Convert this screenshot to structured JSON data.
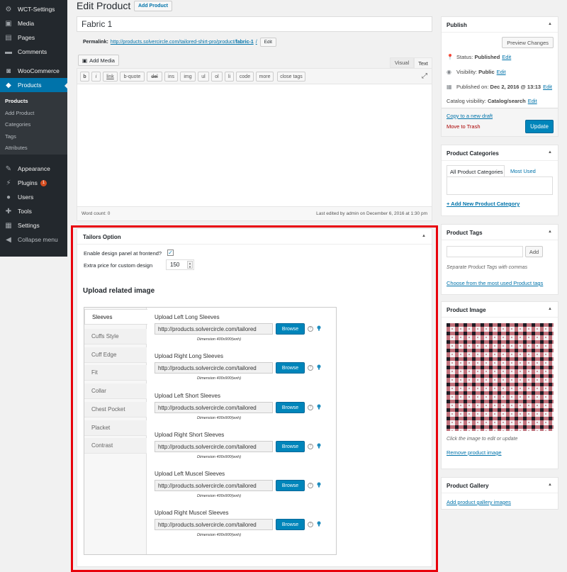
{
  "menu": {
    "items": [
      {
        "label": "WCT-Settings",
        "icon": "gear-icon"
      },
      {
        "label": "Media",
        "icon": "media-icon"
      },
      {
        "label": "Pages",
        "icon": "page-icon"
      },
      {
        "label": "Comments",
        "icon": "comment-icon"
      },
      {
        "label": "WooCommerce",
        "icon": "woocommerce-icon"
      },
      {
        "label": "Products",
        "icon": "products-icon"
      },
      {
        "label": "Appearance",
        "icon": "brush-icon"
      },
      {
        "label": "Plugins",
        "icon": "plugin-icon",
        "badge": "1"
      },
      {
        "label": "Users",
        "icon": "user-icon"
      },
      {
        "label": "Tools",
        "icon": "wrench-icon"
      },
      {
        "label": "Settings",
        "icon": "settings-icon"
      },
      {
        "label": "Collapse menu",
        "icon": "collapse-icon"
      }
    ],
    "submenu": [
      "Products",
      "Add Product",
      "Categories",
      "Tags",
      "Attributes"
    ],
    "colors": {
      "bg": "#23282d",
      "current": "#0073aa"
    }
  },
  "header": {
    "title": "Edit Product",
    "add_button": "Add Product"
  },
  "post": {
    "title": "Fabric 1",
    "permalink_label": "Permalink:",
    "permalink_base": "http://products.solvercircle.com/tailored-shirt-pro/product/",
    "permalink_slug": "fabric-1",
    "permalink_end": "/",
    "permalink_edit": "Edit"
  },
  "editor": {
    "add_media": "Add Media",
    "tab_visual": "Visual",
    "tab_text": "Text",
    "buttons": [
      "b",
      "i",
      "link",
      "b-quote",
      "del",
      "ins",
      "img",
      "ul",
      "ol",
      "li",
      "code",
      "more",
      "close tags"
    ],
    "word_count": "Word count: 0",
    "last_edited": "Last edited by admin on December 6, 2016 at 1:30 pm"
  },
  "tailors": {
    "title": "Tailors Option",
    "design_panel_label": "Enable design panel at frontend?",
    "design_panel_checked": true,
    "check_mark": "✓",
    "extra_price_label": "Extra price for custom design",
    "extra_price_value": "150",
    "upload_heading": "Upload related image",
    "tabs": [
      "Sleeves",
      "Cuffs Style",
      "Cuff Edge",
      "Fit",
      "Collar",
      "Chest Pocket",
      "Placket",
      "Contrast"
    ],
    "uploads": [
      {
        "label": "Upload Left Long Sleeves",
        "value": "http://products.solvercircle.com/tailored"
      },
      {
        "label": "Upload Right Long Sleeves",
        "value": "http://products.solvercircle.com/tailored"
      },
      {
        "label": "Upload Left Short Sleeves",
        "value": "http://products.solvercircle.com/tailored"
      },
      {
        "label": "Upload Right Short Sleeves",
        "value": "http://products.solvercircle.com/tailored"
      },
      {
        "label": "Upload Left Muscel Sleeves",
        "value": "http://products.solvercircle.com/tailored"
      },
      {
        "label": "Upload Right Muscel Sleeves",
        "value": "http://products.solvercircle.com/tailored"
      }
    ],
    "browse_label": "Browse",
    "dimension": "Dimension 400x900(wxh)",
    "help_glyph": "?",
    "highlight_color": "#e8000b"
  },
  "publish": {
    "title": "Publish",
    "preview": "Preview Changes",
    "status_label": "Status:",
    "status_value": "Published",
    "visibility_label": "Visibility:",
    "visibility_value": "Public",
    "published_label": "Published on:",
    "published_value": "Dec 2, 2016 @ 13:13",
    "catalog_label": "Catalog visibility:",
    "catalog_value": "Catalog/search",
    "edit": "Edit",
    "copy_draft": "Copy to a new draft",
    "trash": "Move to Trash",
    "update": "Update"
  },
  "categories": {
    "title": "Product Categories",
    "tab_all": "All Product Categories",
    "tab_most": "Most Used",
    "add_new": "+ Add New Product Category"
  },
  "tags": {
    "title": "Product Tags",
    "add": "Add",
    "hint": "Separate Product Tags with commas",
    "choose": "Choose from the most used Product tags"
  },
  "product_image": {
    "title": "Product Image",
    "hint": "Click the image to edit or update",
    "remove": "Remove product image",
    "colors": {
      "red": "#9c1a2c",
      "dark": "#1d1a22",
      "white": "#f4f2f3"
    }
  },
  "gallery": {
    "title": "Product Gallery",
    "add": "Add product gallery images"
  }
}
